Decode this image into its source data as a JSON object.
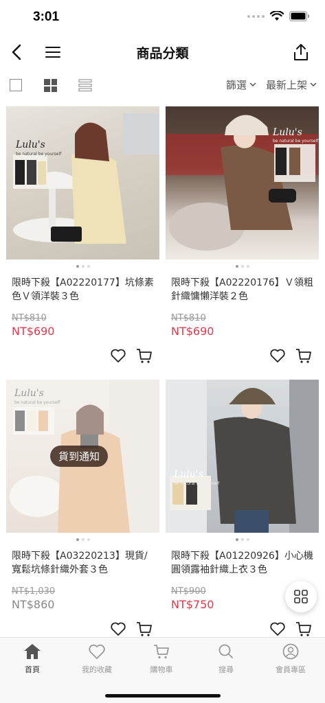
{
  "status_bar": {
    "time": "3:01"
  },
  "nav": {
    "title": "商品分類"
  },
  "toolbar": {
    "filter_label": "篩選",
    "sort_label": "最新上架"
  },
  "products": [
    {
      "title": "限時下殺【A02220177】坑條素色Ｖ領洋裝３色",
      "price_old": "NT$810",
      "price_new": "NT$690",
      "sold_out": false,
      "logo": "Lulu's",
      "logo_sub": "be natural be yourself"
    },
    {
      "title": "限時下殺【A02220176】Ｖ領粗針織慵懶洋裝２色",
      "price_old": "NT$810",
      "price_new": "NT$690",
      "sold_out": false,
      "logo": "Lulu's",
      "logo_sub": "be natural be yourself"
    },
    {
      "title": "限時下殺【A03220213】現貨/寬鬆坑條針織外套３色",
      "price_old": "NT$1,030",
      "price_new": "NT$860",
      "sold_out": true,
      "badge": "貨到通知",
      "logo": "Lulu's",
      "logo_sub": "be natural be yourself"
    },
    {
      "title": "限時下殺【A01220926】小心機圓領露袖針織上衣３色",
      "price_old": "NT$900",
      "price_new": "NT$750",
      "sold_out": false,
      "logo": "Lulu's",
      "logo_sub": "be natural be yourself"
    }
  ],
  "tabs": [
    {
      "label": "首頁",
      "icon": "home-icon",
      "active": true
    },
    {
      "label": "我的收藏",
      "icon": "heart-icon",
      "active": false
    },
    {
      "label": "購物車",
      "icon": "cart-icon",
      "active": false
    },
    {
      "label": "搜尋",
      "icon": "search-icon",
      "active": false
    },
    {
      "label": "會員專區",
      "icon": "user-icon",
      "active": false
    }
  ],
  "colors": {
    "price_accent": "#e8364a",
    "active_tab": "#333333",
    "inactive_tab": "#999999"
  }
}
